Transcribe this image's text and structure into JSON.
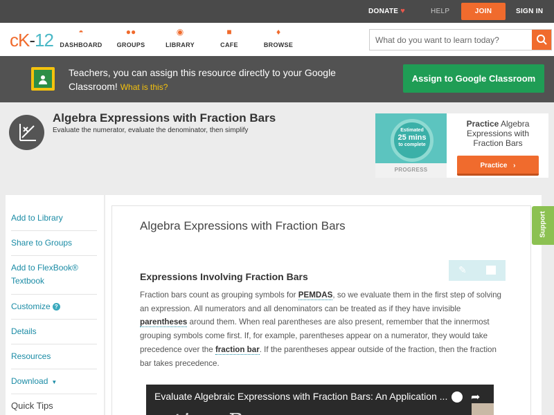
{
  "topbar": {
    "donate": "DONATE",
    "help": "HELP",
    "join": "JOIN",
    "signin": "SIGN IN"
  },
  "nav": {
    "logo_ck": "cK",
    "logo_dash": "-",
    "logo_num": "12",
    "items": [
      {
        "label": "DASHBOARD",
        "icon": "dashboard-icon"
      },
      {
        "label": "GROUPS",
        "icon": "groups-icon"
      },
      {
        "label": "LIBRARY",
        "icon": "library-icon"
      },
      {
        "label": "CAFE",
        "icon": "cafe-icon"
      },
      {
        "label": "BROWSE",
        "icon": "browse-icon"
      }
    ],
    "search_placeholder": "What do you want to learn today?"
  },
  "classroom": {
    "text": "Teachers, you can assign this resource directly to your Google Classroom!",
    "what": "What is this?",
    "button": "Assign to Google Classroom"
  },
  "concept": {
    "title": "Algebra Expressions with Fraction Bars",
    "subtitle": "Evaluate the numerator, evaluate the denominator, then simplify"
  },
  "practice": {
    "estimated": "Estimated",
    "minutes": "25 mins",
    "to_complete": "to complete",
    "progress_label": "PROGRESS",
    "title_bold": "Practice",
    "title_rest": "Algebra Expressions with Fraction Bars",
    "button": "Practice"
  },
  "sidebar": {
    "items": [
      {
        "label": "Add to Library"
      },
      {
        "label": "Share to Groups"
      },
      {
        "label": "Add to FlexBook® Textbook"
      },
      {
        "label": "Customize"
      },
      {
        "label": "Details"
      },
      {
        "label": "Resources"
      },
      {
        "label": "Download"
      }
    ],
    "quick_tips": "Quick Tips"
  },
  "main": {
    "heading": "Algebra Expressions with Fraction Bars",
    "section": "Expressions Involving Fraction Bars",
    "p1": "Fraction bars count as grouping symbols for ",
    "k1": "PEMDAS",
    "p2": ", so we evaluate them in the first step of solving an expression. All numerators and all denominators can be treated as if they have invisible ",
    "k2": "parentheses",
    "p3": " around them. When real parentheses are also present, remember that the innermost grouping symbols come first. If, for example, parentheses appear on a numerator, they would take precedence over the ",
    "k3": "fraction bar",
    "p4": ". If the parentheses appear outside of the fraction, then the fraction bar takes precedence.",
    "video_title": "Evaluate Algebraic Expressions with Fraction Bars: An Application ...",
    "video_chalk": "action Bars as"
  },
  "support": "Support",
  "colors": {
    "accent_orange": "#f06b2d",
    "link_teal": "#1a8ba5",
    "classroom_green": "#1f9d55",
    "support_green": "#8cc152"
  }
}
